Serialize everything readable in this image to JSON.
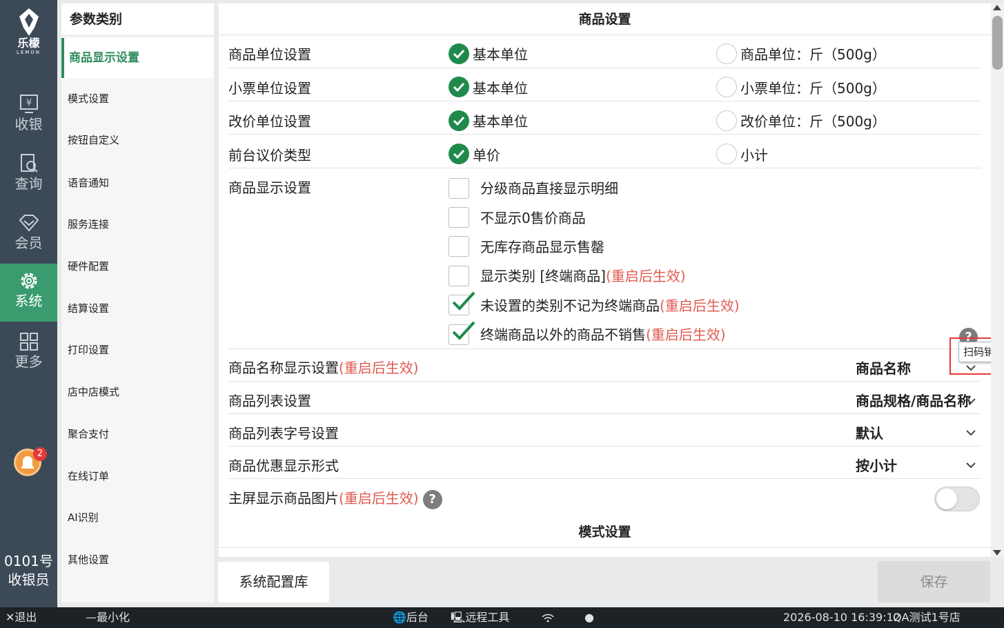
{
  "colors": {
    "nav_bg": "#3c4a58",
    "nav_active": "#3a9b6e",
    "accent_green": "#1f8a4c",
    "warning_red": "#e05a50"
  },
  "logo": {
    "name": "乐檬",
    "sub": "LEMON"
  },
  "nav": [
    {
      "label": "收银",
      "icon": "cashier-icon"
    },
    {
      "label": "查询",
      "icon": "search-doc-icon"
    },
    {
      "label": "会员",
      "icon": "diamond-icon"
    },
    {
      "label": "系统",
      "icon": "gear-icon",
      "active": true
    },
    {
      "label": "更多",
      "icon": "grid-icon"
    }
  ],
  "notification_count": "2",
  "operator": {
    "line1": "0101号",
    "line2": "收银员"
  },
  "categories": {
    "title": "参数类别",
    "items": [
      "商品显示设置",
      "模式设置",
      "按钮自定义",
      "语音通知",
      "服务连接",
      "硬件配置",
      "结算设置",
      "打印设置",
      "店中店模式",
      "聚合支付",
      "在线订单",
      "AI识别",
      "其他设置"
    ]
  },
  "main": {
    "section_title": "商品设置",
    "radio_rows": [
      {
        "label": "商品单位设置",
        "opt1": "基本单位",
        "opt2": "商品单位：斤（500g）"
      },
      {
        "label": "小票单位设置",
        "opt1": "基本单位",
        "opt2": "小票单位：斤（500g）"
      },
      {
        "label": "改价单位设置",
        "opt1": "基本单位",
        "opt2": "改价单位：斤（500g）"
      },
      {
        "label": "前台议价类型",
        "opt1": "单价",
        "opt2": "小计"
      }
    ],
    "display_label": "商品显示设置",
    "checkboxes": [
      {
        "text": "分级商品直接显示明细",
        "note": "",
        "checked": false
      },
      {
        "text": "不显示0售价商品",
        "note": "",
        "checked": false
      },
      {
        "text": "无库存商品显示售罄",
        "note": "",
        "checked": false
      },
      {
        "text": "显示类别 [终端商品]",
        "note": "(重启后生效)",
        "checked": false
      },
      {
        "text": "未设置的类别不记为终端商品",
        "note": "(重启后生效)",
        "checked": true
      },
      {
        "text": "终端商品以外的商品不销售",
        "note": "(重启后生效)",
        "checked": true
      }
    ],
    "tooltip": "扫码销售商品除外",
    "name_display": {
      "label": "商品名称显示设置",
      "note": "(重启后生效)",
      "value": "商品名称"
    },
    "list_setting": {
      "label": "商品列表设置",
      "value": "商品规格/商品名称"
    },
    "font_setting": {
      "label": "商品列表字号设置",
      "value": "默认"
    },
    "discount_setting": {
      "label": "商品优惠显示形式",
      "value": "按小计"
    },
    "image_setting": {
      "label": "主屏显示商品图片",
      "note": "(重启后生效)",
      "enabled": false
    },
    "next_section_title": "模式设置",
    "help_mark": "?"
  },
  "buttons": {
    "config_library": "系统配置库",
    "save": "保存"
  },
  "statusbar": {
    "exit": "退出",
    "minimize": "最小化",
    "backend": "后台",
    "remote": "远程工具",
    "datetime": "2026-08-10 16:39:12",
    "store": "QA测试1号店"
  }
}
